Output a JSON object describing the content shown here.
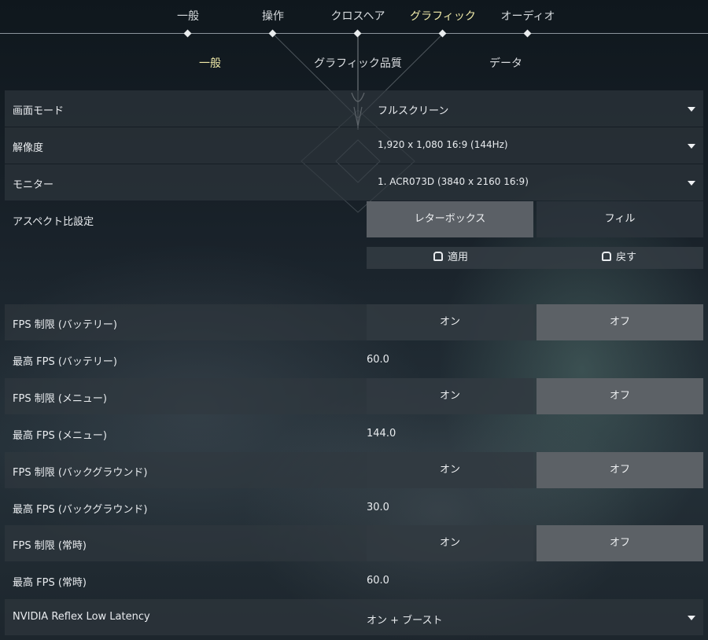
{
  "nav": {
    "tabs": [
      {
        "label": "一般"
      },
      {
        "label": "操作"
      },
      {
        "label": "クロスヘア"
      },
      {
        "label": "グラフィック"
      },
      {
        "label": "オーディオ"
      }
    ],
    "active_tab": "グラフィック",
    "subtabs": [
      {
        "label": "一般"
      },
      {
        "label": "グラフィック品質"
      },
      {
        "label": "データ"
      }
    ],
    "active_subtab": "一般"
  },
  "settings": {
    "display_mode": {
      "label": "画面モード",
      "value": "フルスクリーン"
    },
    "resolution": {
      "label": "解像度",
      "value": "1,920 x 1,080 16:9 (144Hz)"
    },
    "monitor": {
      "label": "モニター",
      "value": "1. ACR073D (3840 x  2160 16:9)"
    },
    "aspect": {
      "label": "アスペクト比設定",
      "options": [
        "レターボックス",
        "フィル"
      ],
      "selected": "レターボックス"
    },
    "apply": {
      "apply_label": "適用",
      "revert_label": "戻す"
    },
    "fps_battery": {
      "label": "FPS 制限 (バッテリー)",
      "on": "オン",
      "off": "オフ",
      "selected": "オフ"
    },
    "max_fps_battery": {
      "label": "最高 FPS (バッテリー)",
      "value": "60.0"
    },
    "fps_menu": {
      "label": "FPS 制限 (メニュー)",
      "on": "オン",
      "off": "オフ",
      "selected": "オフ"
    },
    "max_fps_menu": {
      "label": "最高 FPS (メニュー)",
      "value": "144.0"
    },
    "fps_background": {
      "label": "FPS 制限 (バックグラウンド)",
      "on": "オン",
      "off": "オフ",
      "selected": "オフ"
    },
    "max_fps_background": {
      "label": "最高 FPS (バックグラウンド)",
      "value": "30.0"
    },
    "fps_always": {
      "label": "FPS 制限 (常時)",
      "on": "オン",
      "off": "オフ",
      "selected": "オフ"
    },
    "max_fps_always": {
      "label": "最高 FPS (常時)",
      "value": "60.0"
    },
    "reflex": {
      "label": "NVIDIA Reflex Low Latency",
      "value": "オン + ブースト"
    }
  },
  "colors": {
    "accent": "#efe9a8",
    "selected_button": "#5b6066"
  }
}
